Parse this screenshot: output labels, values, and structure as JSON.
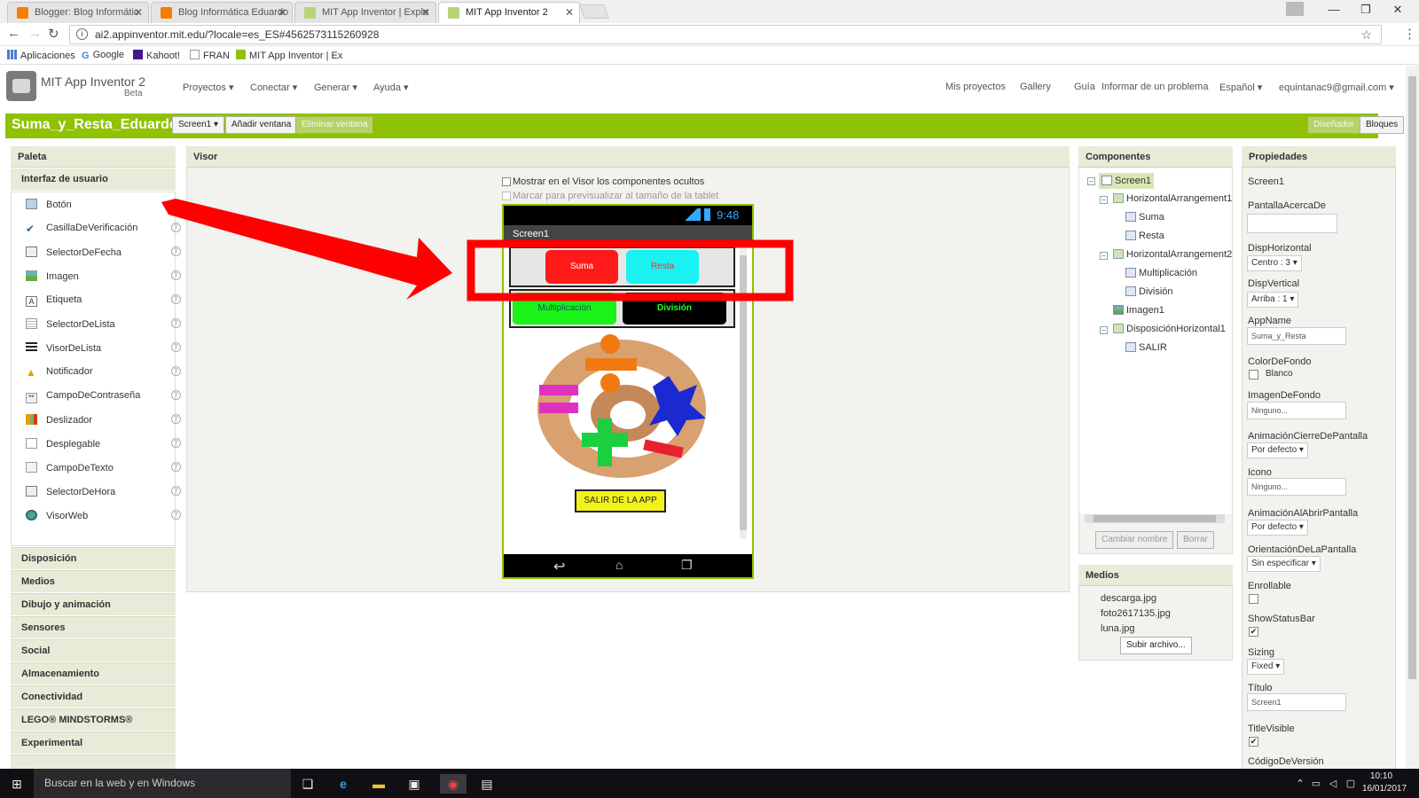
{
  "browser": {
    "tabs": [
      {
        "label": "Blogger: Blog Informátic"
      },
      {
        "label": "Blog Informática Eduardo"
      },
      {
        "label": "MIT App Inventor | Explo"
      },
      {
        "label": "MIT App Inventor 2"
      }
    ],
    "url": "ai2.appinventor.mit.edu/?locale=es_ES#4562573115260928",
    "bookmarks": [
      "Aplicaciones",
      "Google",
      "Kahoot!",
      "FRAN",
      "MIT App Inventor | Ex"
    ]
  },
  "header": {
    "app_name": "MIT App Inventor 2",
    "beta": "Beta",
    "menus": [
      "Proyectos ▾",
      "Conectar ▾",
      "Generar ▾",
      "Ayuda ▾"
    ],
    "right_links": [
      "Mis proyectos",
      "Gallery",
      "Guía",
      "Informar de un problema",
      "Español ▾",
      "equintanac9@gmail.com ▾"
    ]
  },
  "project": {
    "name": "Suma_y_Resta_Eduardo",
    "screen_select": "Screen1 ▾",
    "add_screen": "Añadir ventana",
    "remove_screen": "Eliminar ventana",
    "designer": "Diseñador",
    "blocks": "Bloques"
  },
  "palette": {
    "title": "Paleta",
    "section": "Interfaz de usuario",
    "items": [
      "Botón",
      "CasillaDeVerificación",
      "SelectorDeFecha",
      "Imagen",
      "Etiqueta",
      "SelectorDeLista",
      "VisorDeLista",
      "Notificador",
      "CampoDeContraseña",
      "Deslizador",
      "Desplegable",
      "CampoDeTexto",
      "SelectorDeHora",
      "VisorWeb"
    ],
    "categories": [
      "Disposición",
      "Medios",
      "Dibujo y animación",
      "Sensores",
      "Social",
      "Almacenamiento",
      "Conectividad",
      "LEGO® MINDSTORMS®",
      "Experimental"
    ],
    "help": "?"
  },
  "viewer": {
    "title": "Visor",
    "show_hidden": "Mostrar en el Visor los componentes ocultos",
    "tablet_preview": "Marcar para previsualizar al tamaño de la tablet",
    "time": "9:48",
    "screen_title": "Screen1",
    "btn_suma": "Suma",
    "btn_resta": "Resta",
    "btn_mult": "Multiplicación",
    "btn_div": "División",
    "btn_salir": "SALIR DE LA APP",
    "colors": {
      "suma": "#ff1a1a",
      "resta": "#1af2f2",
      "mult": "#1af21a",
      "div": "#000000",
      "salir": "#f2f21a",
      "annotation": "#ff0000"
    }
  },
  "components": {
    "title": "Componentes",
    "tree": [
      "Screen1",
      "HorizontalArrangement1",
      "Suma",
      "Resta",
      "HorizontalArrangement2",
      "Multiplicación",
      "División",
      "Imagen1",
      "DisposiciónHorizontal1",
      "SALIR"
    ],
    "rename": "Cambiar nombre",
    "delete": "Borrar"
  },
  "media": {
    "title": "Medios",
    "files": [
      "descarga.jpg",
      "foto2617135.jpg",
      "luna.jpg"
    ],
    "upload": "Subir archivo..."
  },
  "properties": {
    "title": "Propiedades",
    "component": "Screen1",
    "labels": [
      "PantallaAcercaDe",
      "DispHorizontal",
      "DispVertical",
      "AppName",
      "ColorDeFondo",
      "ImagenDeFondo",
      "AnimaciónCierreDePantalla",
      "Icono",
      "AnimaciónAlAbrirPantalla",
      "OrientaciónDeLaPantalla",
      "Enrollable",
      "ShowStatusBar",
      "Sizing",
      "Título",
      "TitleVisible",
      "CódigoDeVersión"
    ],
    "disp_h": "Centro : 3 ▾",
    "disp_v": "Arriba : 1 ▾",
    "app_name": "Suma_y_Resta",
    "bg_color": "Blanco",
    "bg_image": "Ninguno...",
    "close_anim": "Por defecto ▾",
    "icon": "Ninguno...",
    "open_anim": "Por defecto ▾",
    "orientation": "Sin especificar ▾",
    "sizing": "Fixed ▾",
    "title_value": "Screen1"
  },
  "taskbar": {
    "search": "Buscar en la web y en Windows",
    "time": "10:10",
    "date": "16/01/2017"
  }
}
